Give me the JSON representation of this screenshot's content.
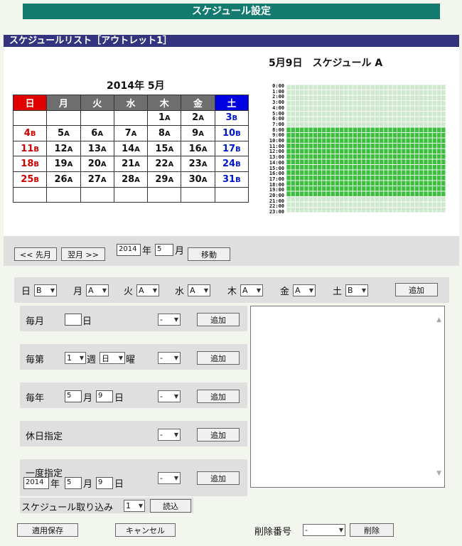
{
  "header": {
    "title": "スケジュール設定"
  },
  "list_bar": {
    "title": "スケジュールリスト［アウトレット1］"
  },
  "calendar": {
    "title": "2014年 5月",
    "weekdays": [
      {
        "label": "日",
        "bg": "#e00000"
      },
      {
        "label": "月",
        "bg": "#6e6e6e"
      },
      {
        "label": "火",
        "bg": "#6e6e6e"
      },
      {
        "label": "水",
        "bg": "#6e6e6e"
      },
      {
        "label": "木",
        "bg": "#6e6e6e"
      },
      {
        "label": "金",
        "bg": "#6e6e6e"
      },
      {
        "label": "土",
        "bg": "#0000e0"
      }
    ],
    "weeks": [
      [
        [
          "",
          ""
        ],
        [
          "",
          ""
        ],
        [
          "",
          ""
        ],
        [
          "",
          ""
        ],
        [
          "1",
          "A"
        ],
        [
          "2",
          "A"
        ],
        [
          "3",
          "B"
        ]
      ],
      [
        [
          "4",
          "B"
        ],
        [
          "5",
          "A"
        ],
        [
          "6",
          "A"
        ],
        [
          "7",
          "A"
        ],
        [
          "8",
          "A"
        ],
        [
          "9",
          "A"
        ],
        [
          "10",
          "B"
        ]
      ],
      [
        [
          "11",
          "B"
        ],
        [
          "12",
          "A"
        ],
        [
          "13",
          "A"
        ],
        [
          "14",
          "A"
        ],
        [
          "15",
          "A"
        ],
        [
          "16",
          "A"
        ],
        [
          "17",
          "B"
        ]
      ],
      [
        [
          "18",
          "B"
        ],
        [
          "19",
          "A"
        ],
        [
          "20",
          "A"
        ],
        [
          "21",
          "A"
        ],
        [
          "22",
          "A"
        ],
        [
          "23",
          "A"
        ],
        [
          "24",
          "B"
        ]
      ],
      [
        [
          "25",
          "B"
        ],
        [
          "26",
          "A"
        ],
        [
          "27",
          "A"
        ],
        [
          "28",
          "A"
        ],
        [
          "29",
          "A"
        ],
        [
          "30",
          "A"
        ],
        [
          "31",
          "B"
        ]
      ],
      [
        [
          "",
          ""
        ],
        [
          "",
          ""
        ],
        [
          "",
          ""
        ],
        [
          "",
          ""
        ],
        [
          "",
          ""
        ],
        [
          "",
          ""
        ],
        [
          "",
          ""
        ]
      ]
    ]
  },
  "schedule_view": {
    "title": "5月9日　スケジュール A",
    "hours": [
      "0:00",
      "1:00",
      "2:00",
      "3:00",
      "4:00",
      "5:00",
      "6:00",
      "7:00",
      "8:00",
      "9:00",
      "10:00",
      "11:00",
      "12:00",
      "13:00",
      "14:00",
      "15:00",
      "16:00",
      "17:00",
      "18:00",
      "19:00",
      "20:00",
      "21:00",
      "22:00",
      "23:00"
    ],
    "on_hours": [
      8,
      9,
      10,
      11,
      12,
      13,
      14,
      15,
      16,
      17,
      18,
      19,
      20
    ],
    "on_color": "#3fbf3f",
    "off_color": "#cde8cd"
  },
  "nav": {
    "prev_label": "<< 先月",
    "next_label": "翌月 >>",
    "year_value": "2014",
    "year_unit": "年",
    "month_value": "5",
    "month_unit": "月",
    "move_label": "移動"
  },
  "weekday_row": {
    "items": [
      {
        "label": "日",
        "value": "B"
      },
      {
        "label": "月",
        "value": "A"
      },
      {
        "label": "火",
        "value": "A"
      },
      {
        "label": "水",
        "value": "A"
      },
      {
        "label": "木",
        "value": "A"
      },
      {
        "label": "金",
        "value": "A"
      },
      {
        "label": "土",
        "value": "B"
      }
    ],
    "add_label": "追加"
  },
  "monthly": {
    "label": "毎月",
    "day_value": "",
    "day_unit": "日",
    "sched_value": "-",
    "add_label": "追加"
  },
  "nth_week": {
    "label": "毎第",
    "week_value": "1",
    "week_unit": "週",
    "day_value": "日",
    "day_unit": "曜",
    "sched_value": "-",
    "add_label": "追加"
  },
  "yearly": {
    "label": "毎年",
    "month_value": "5",
    "month_unit": "月",
    "day_value": "9",
    "day_unit": "日",
    "sched_value": "-",
    "add_label": "追加"
  },
  "holiday": {
    "label": "休日指定",
    "sched_value": "-",
    "add_label": "追加"
  },
  "once": {
    "label": "一度指定",
    "year_value": "2014",
    "year_unit": "年",
    "month_value": "5",
    "month_unit": "月",
    "day_value": "9",
    "day_unit": "日",
    "sched_value": "-",
    "add_label": "追加"
  },
  "import": {
    "label": "スケジュール取り込み",
    "value": "1",
    "button_label": "読込"
  },
  "footer": {
    "apply_label": "適用保存",
    "cancel_label": "キャンセル",
    "delete_number_label": "削除番号",
    "delete_number_value": "-",
    "delete_label": "削除"
  }
}
